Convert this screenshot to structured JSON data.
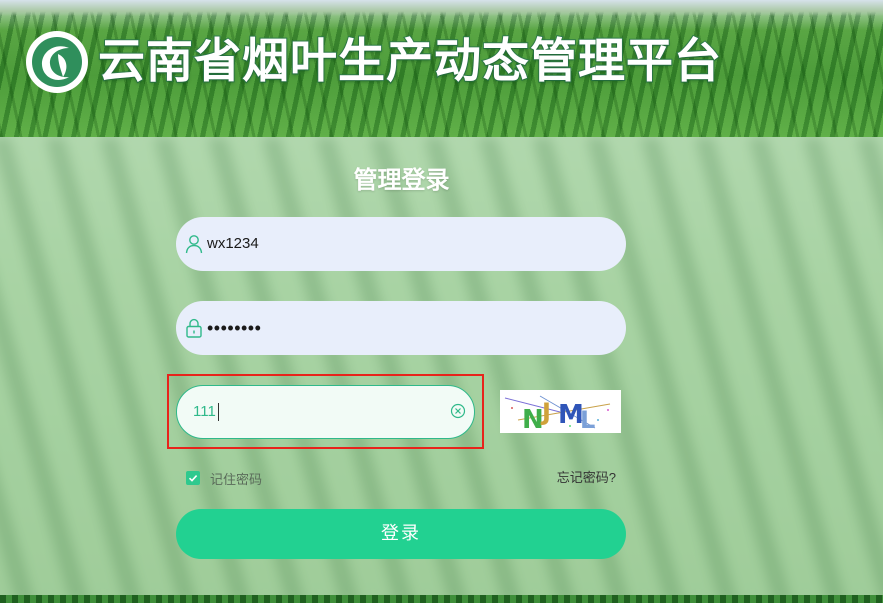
{
  "header": {
    "title": "云南省烟叶生产动态管理平台",
    "logo_icon": "leaf-c-logo-icon"
  },
  "login": {
    "title": "管理登录",
    "username": {
      "value": "wx1234",
      "icon": "user-icon"
    },
    "password": {
      "masked_value": "••••••••",
      "icon": "lock-icon"
    },
    "captcha": {
      "value": "111",
      "clear_icon": "clear-circle-icon",
      "image_text": "NJML"
    },
    "remember_label": "记住密码",
    "remember_checked": true,
    "forgot_label": "忘记密码?",
    "submit_label": "登录"
  },
  "colors": {
    "accent": "#22d191",
    "highlight": "#e8231b",
    "input_bg": "#e8eefb"
  }
}
